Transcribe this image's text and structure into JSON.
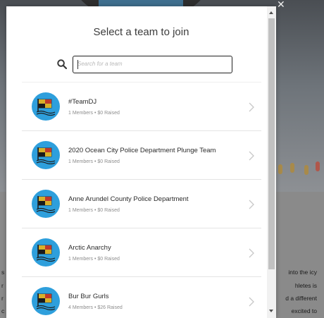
{
  "modal": {
    "title": "Select a team to join",
    "search": {
      "placeholder": "Search for a team",
      "value": ""
    },
    "teams": [
      {
        "name": "#TeamDJ",
        "meta": "1 Members • $0 Raised"
      },
      {
        "name": "2020 Ocean City Police Department Plunge Team",
        "meta": "1 Members • $0 Raised"
      },
      {
        "name": "Anne Arundel County Police Department",
        "meta": "1 Members • $0 Raised"
      },
      {
        "name": "Arctic Anarchy",
        "meta": "1 Members • $0 Raised"
      },
      {
        "name": "Bur Bur Gurls",
        "meta": "4 Members • $26 Raised"
      }
    ]
  },
  "background": {
    "article_fragments_right": [
      "into the icy",
      "hletes is",
      "d a different",
      "excited to"
    ],
    "article_fragments_left": [
      "s",
      "r",
      "r",
      "c"
    ]
  },
  "colors": {
    "avatar": "#2e9fdc",
    "overlay": "#6e6e6e",
    "modal_bg": "#ffffff"
  },
  "icons": {
    "search": "search-icon",
    "chevron": "chevron-right-icon",
    "team_logo": "maryland-flag-icon",
    "close": "close-icon"
  }
}
